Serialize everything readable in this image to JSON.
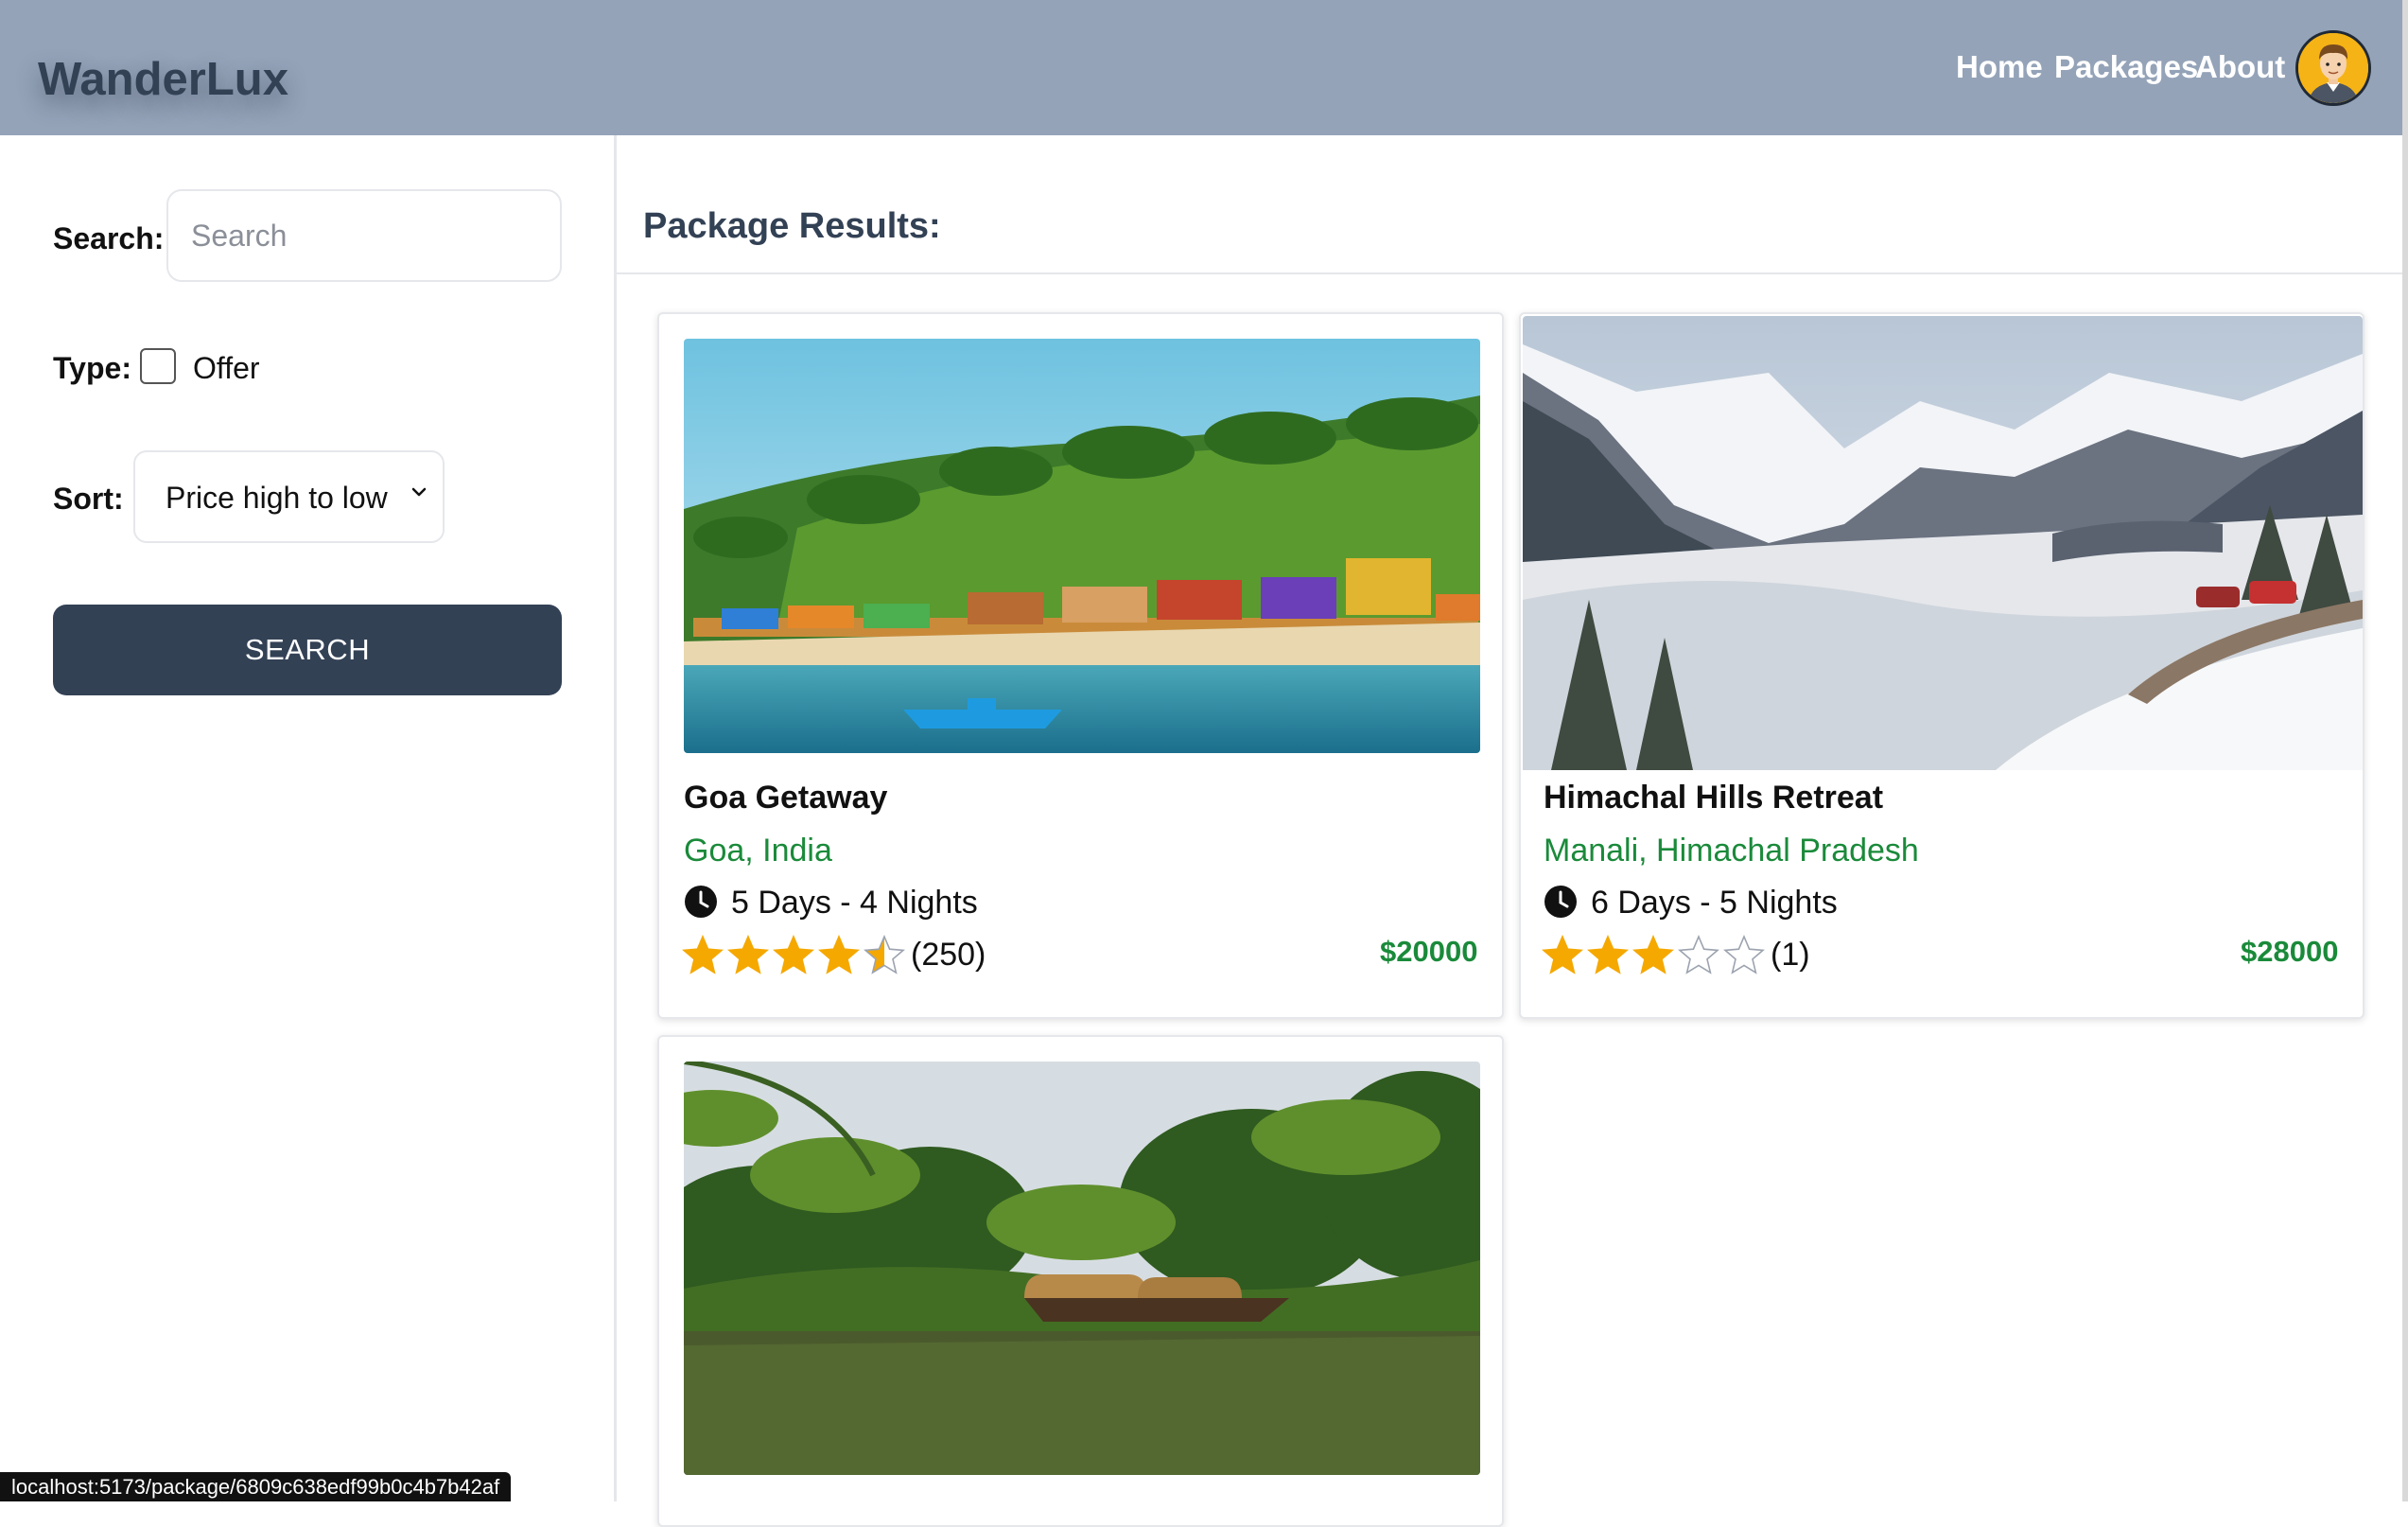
{
  "header": {
    "brand": "WanderLux",
    "nav": [
      {
        "label": "Home"
      },
      {
        "label": "Packages"
      },
      {
        "label": "About"
      }
    ]
  },
  "sidebar": {
    "search_label": "Search:",
    "search_placeholder": "Search",
    "search_value": "",
    "type_label": "Type:",
    "offer_label": "Offer",
    "offer_checked": false,
    "sort_label": "Sort:",
    "sort_value": "Price high to low",
    "search_button": "SEARCH"
  },
  "results": {
    "title": "Package Results:",
    "packages": [
      {
        "name": "Goa Getaway",
        "location": "Goa, India",
        "duration": "5 Days - 4 Nights",
        "rating": 4.5,
        "rating_count": "(250)",
        "price": "$20000",
        "image": "beach-palms"
      },
      {
        "name": "Himachal Hills Retreat",
        "location": "Manali, Himachal Pradesh",
        "duration": "6 Days - 5 Nights",
        "rating": 3,
        "rating_count": "(1)",
        "price": "$28000",
        "image": "snow-mountains"
      },
      {
        "image": "backwater-houseboat"
      }
    ]
  },
  "status_bar": {
    "url": "localhost:5173/package/6809c638edf99b0c4b7b42af"
  },
  "colors": {
    "header_bg": "#94a3b8",
    "brand_text": "#334155",
    "button_bg": "#334155",
    "location_green": "#1a8a3a",
    "star_gold": "#f5a800"
  }
}
